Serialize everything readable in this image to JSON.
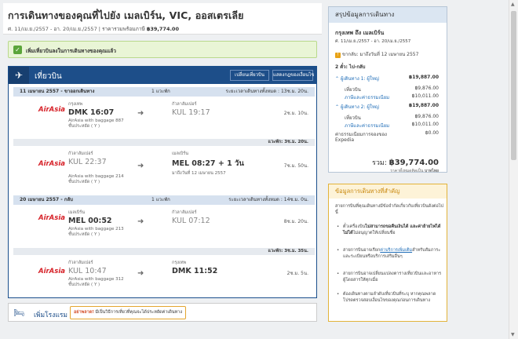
{
  "header": {
    "title": "การเดินทางของคุณที่ไปยัง เมลเบิร์น, VIC, ออสเตรเลีย",
    "dates": "ศ. 11/เม.ย./2557 - อา. 20/เม.ย./2557",
    "price_label": "ราคารวมพร้อมภาษี",
    "price": "฿39,774.00"
  },
  "confirm": {
    "text": "เพิ่มเที่ยวบินลงในการเดินทางของคุณแล้ว"
  },
  "flights": {
    "title": "เที่ยวบิน",
    "change_button": "เปลี่ยนเที่ยวบิน",
    "rules_button": "แสดงกฎของเงื่อนไข",
    "outbound": {
      "date": "11 เมษายน 2557 - ขาออกเดินทาง",
      "stops": "1 แวะพัก",
      "total": "ระยะเวลาเดินทางทั้งหมด : 13ช.ม. 20น.",
      "leg1": {
        "airline": "AirAsia",
        "dep_city": "กรุงเทพ",
        "dep": "DMK 16:07",
        "arr_city": "กัวลาลัมเปอร์",
        "arr": "KUL 19:17",
        "flight": "AirAsia with baggage 887",
        "cabin": "ชั้นประหยัด ( Y )",
        "duration": "2ช.ม. 10น."
      },
      "layover": "แวะพัก: 3ช.ม. 20น.",
      "leg2": {
        "airline": "AirAsia",
        "dep_city": "กัวลาลัมเปอร์",
        "dep": "KUL 22:37",
        "arr_city": "เมลเบิร์น",
        "arr": "MEL 08:27 + 1 วัน",
        "next_day": "มาถึงวันที่ 12 เมษายน 2557",
        "flight": "AirAsia with baggage 214",
        "cabin": "ชั้นประหยัด ( Y )",
        "duration": "7ช.ม. 50น."
      }
    },
    "return": {
      "date": "20 เมษายน 2557 - กลับ",
      "stops": "1 แวะพัก",
      "total": "ระยะเวลาเดินทางทั้งหมด : 14ช.ม. 0น.",
      "leg1": {
        "airline": "AirAsia",
        "dep_city": "เมลเบิร์น",
        "dep": "MEL 00:52",
        "arr_city": "กัวลาลัมเปอร์",
        "arr": "KUL 07:12",
        "flight": "AirAsia with baggage 213",
        "cabin": "ชั้นประหยัด ( Y )",
        "duration": "8ช.ม. 20น."
      },
      "layover": "แวะพัก: 3ช.ม. 35น.",
      "leg2": {
        "airline": "AirAsia",
        "dep_city": "กัวลาลัมเปอร์",
        "dep": "KUL 10:47",
        "arr_city": "กรุงเทพ",
        "arr": "DMK 11:52",
        "flight": "AirAsia with baggage 312",
        "cabin": "ชั้นประหยัด ( Y )",
        "duration": "2ช.ม. 5น."
      }
    }
  },
  "hotel": {
    "label": "เพิ่มโรงแรม",
    "tip_strong": "อย่าพลาด!",
    "tip_text": "มีเป็นวิธีการเที่ยวที่คุณจะได้ประหยัดค่าเดินทาง"
  },
  "summary": {
    "title": "สรุปข้อมูลการเดินทาง",
    "route": "กรุงเทพ ถึง เมลเบิร์น",
    "dates": "ศ. 11/เม.ย./2557 - อา. 20/เม.ย./2557",
    "return_note": "ขากลับ: มาถึงวันที่ 12 เมษายน 2557",
    "tickets": "2 ตั๋ว: ไป-กลับ",
    "traveler1": "ผู้เดินทาง 1: ผู้ใหญ่",
    "traveler1_total": "฿19,887.00",
    "flight_label": "เที่ยวบิน",
    "flight1": "฿9,876.00",
    "tax_label": "ภาษีและค่าธรรมเนียม",
    "tax1": "฿10,011.00",
    "traveler2": "ผู้เดินทาง 2: ผู้ใหญ่",
    "traveler2_total": "฿19,887.00",
    "flight2": "฿9,876.00",
    "tax2": "฿10,011.00",
    "fee_label": "ค่าธรรมเนียมการจองของ",
    "fee_provider": "Expedia",
    "fee": "฿0.00",
    "total_label": "รวม:",
    "total": "฿39,774.00",
    "currency_note": "ราคาทั้งหมดคิดเป็น",
    "currency": "บาทไทย"
  },
  "info": {
    "title": "ข้อมูลการเดินทางที่สำคัญ",
    "intro": "สายการบินที่คุณเดินทางมีข้อจำกัดเกี่ยวกับเที่ยวบินดังต่อไปนี้",
    "b1_pre": "ตั๋วเครื่องบิน",
    "b1_strong": "ไม่สามารถขอคืนเงินได้ และค่าย้ายไฟได้ไม่ได้",
    "b1_post": "ไม่อนุญาตให้เปลี่ยนชื่อ",
    "b2_pre": "สายการบินอาจเรียก",
    "b2_link": "ค่าบริการเพิ่มเติม",
    "b2_post": "สำหรับสัมภาระและระเบียนหรือบริการเสริมอื่นๆ",
    "b3": "สายการบินอาจเปลี่ยนแปลงตารางเที่ยวบินและอาหารผู้โดยสารให้ทุกเมื่อ",
    "b4": "ต้องเดินทางตามลำดับเที่ยวบินที่ระบุ หากคุณพลาด โปรดตรวจสอบเงื่อนไขของคุณก่อนการเดินทาง"
  }
}
